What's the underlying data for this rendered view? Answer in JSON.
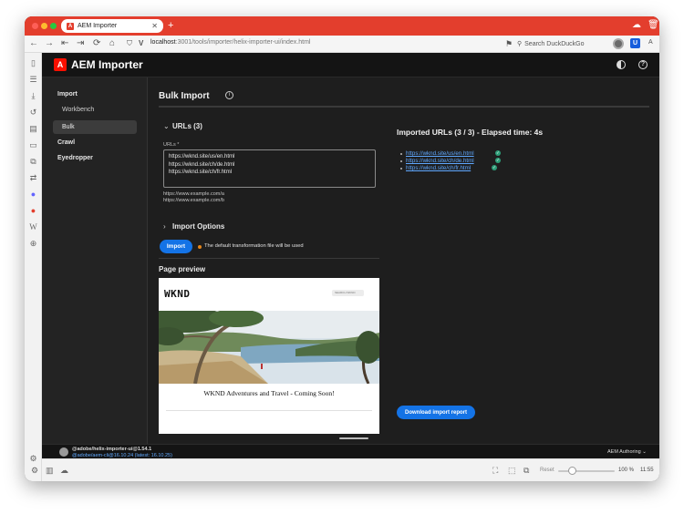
{
  "browser": {
    "tab_title": "AEM Importer",
    "tab_logo": "A",
    "new_tab_glyph": "+",
    "url_host": "localhost",
    "url_path": ":3001/tools/importer/helix-importer-ui/index.html",
    "search_placeholder": "Search DuckDuckGo",
    "bitwarden_glyph": "U",
    "page_menu_glyph": "A",
    "traffic_lights": [
      "#fe5f57",
      "#febc2e",
      "#28c840"
    ]
  },
  "app": {
    "logo_glyph": "A",
    "title": "AEM Importer",
    "help_glyph": "?",
    "nav": {
      "import": "Import",
      "workbench": "Workbench",
      "bulk": "Bulk",
      "crawl": "Crawl",
      "eyedropper": "Eyedropper"
    },
    "footer": {
      "version1": "@adobe/helix-importer-ui@1.54.1",
      "version2": "@adobe/aem-cli@16.10.24 (latest: 16.10.25)",
      "environment": "AEM Authoring"
    }
  },
  "bulk": {
    "title": "Bulk Import",
    "info_glyph": "i",
    "urls_section": "URLs (3)",
    "urls_label": "URLs",
    "required_mark": "*",
    "urls": [
      "https://wknd.site/us/en.html",
      "https://wknd.site/ch/de.html",
      "https://wknd.site/ch/fr.html"
    ],
    "help_lines": [
      "https://www.example.com/a",
      "https://www.example.com/b"
    ],
    "options_section": "Import Options",
    "import_button": "Import",
    "status_text": "The default transformation file will be used",
    "preview_title": "Page preview"
  },
  "preview": {
    "logo": "WKND",
    "search_placeholder": "SEARCH WKND",
    "tagline": "WKND Adventures and Travel - Coming Soon!"
  },
  "results": {
    "title": "Imported URLs (3 / 3) - Elapsed time: 4s",
    "items": [
      "https://wknd.site/us/en.html",
      "https://wknd.site/ch/de.html",
      "https://wknd.site/ch/fr.html"
    ],
    "download_button": "Download import report"
  },
  "statusbar": {
    "reset_label": "Reset",
    "zoom": "100 %",
    "clock": "11:55"
  },
  "colors": {
    "accent_blue": "#1473e6",
    "browser_red": "#e33e2d",
    "success_green": "#2d9d78",
    "link_blue": "#5fa8ff",
    "warning_orange": "#e68619"
  }
}
